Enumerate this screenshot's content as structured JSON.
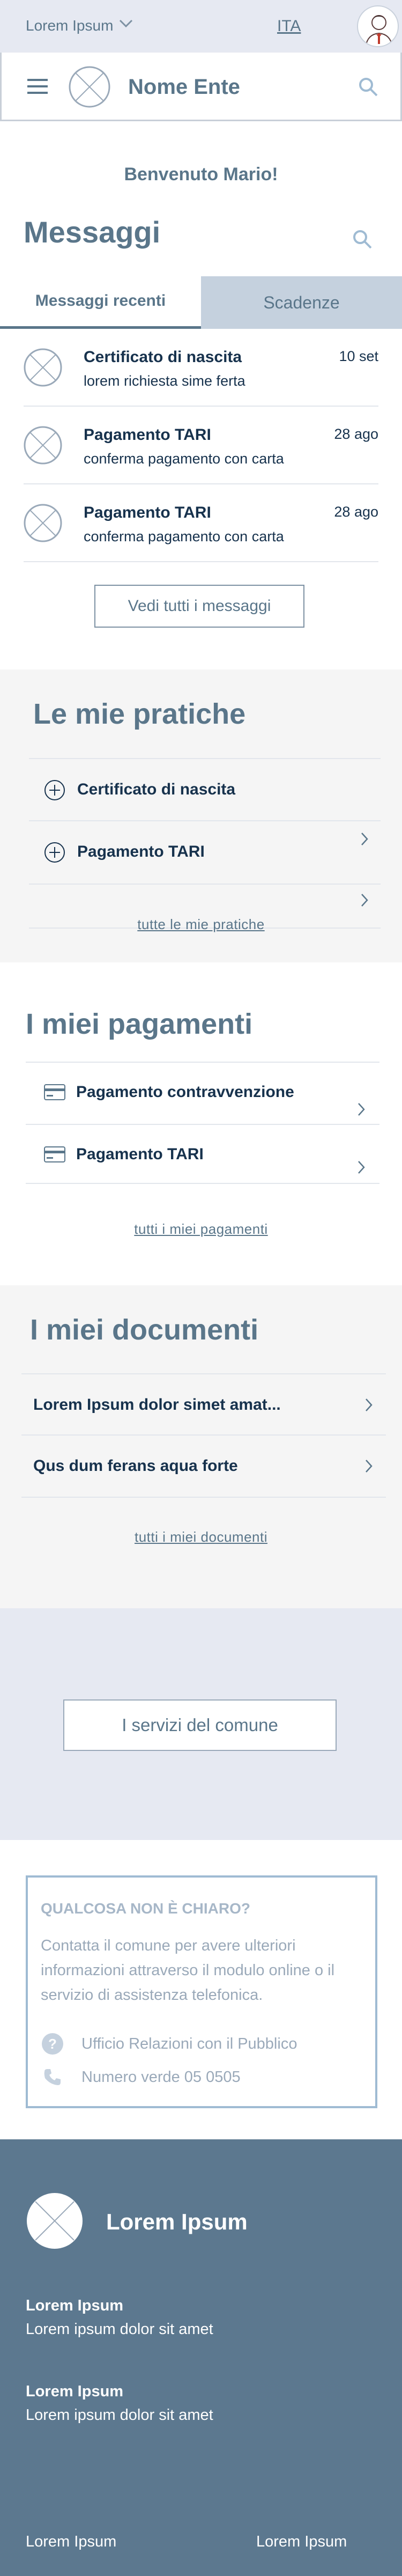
{
  "topbar": {
    "region": "Lorem Ipsum",
    "language": "ITA"
  },
  "header": {
    "entity_name": "Nome Ente"
  },
  "welcome": "Benvenuto Mario!",
  "messages": {
    "title": "Messaggi",
    "tabs": [
      "Messaggi recenti",
      "Scadenze"
    ],
    "items": [
      {
        "title": "Certificato di nascita",
        "subtitle": "lorem richiesta sime ferta",
        "date": "10 set"
      },
      {
        "title": "Pagamento TARI",
        "subtitle": "conferma pagamento con carta",
        "date": "28 ago"
      },
      {
        "title": "Pagamento TARI",
        "subtitle": "conferma pagamento con carta",
        "date": "28 ago"
      }
    ],
    "see_all": "Vedi tutti i messaggi"
  },
  "pratiche": {
    "title": "Le mie pratiche",
    "items": [
      "Certificato di nascita",
      "Pagamento TARI"
    ],
    "link": "tutte le mie pratiche"
  },
  "pagamenti": {
    "title": "I miei pagamenti",
    "items": [
      "Pagamento contravvenzione",
      "Pagamento TARI"
    ],
    "link": "tutti i miei pagamenti"
  },
  "documenti": {
    "title": "I miei documenti",
    "items": [
      "Lorem Ipsum dolor simet amat...",
      "Qus dum ferans aqua forte"
    ],
    "link": "tutti i miei documenti"
  },
  "services_button": "I servizi del comune",
  "help": {
    "title": "QUALCOSA NON È CHIARO?",
    "text": "Contatta il comune per avere ulteriori informazioni attraverso il modulo online o il servizio di assistenza telefonica.",
    "office": "Ufficio Relazioni con il Pubblico",
    "phone": "Numero verde 05 0505"
  },
  "footer": {
    "brand": "Lorem Ipsum",
    "blocks": [
      {
        "title": "Lorem Ipsum",
        "text": "Lorem ipsum dolor sit amet"
      },
      {
        "title": "Lorem Ipsum",
        "text": "Lorem ipsum dolor sit amet"
      }
    ],
    "links": [
      "Lorem Ipsum",
      "Lorem Ipsum"
    ]
  },
  "colors": {
    "primary": "#5a768a",
    "text_dark": "#17324d",
    "topbar_bg": "#e6e9f2",
    "tab_inactive_bg": "#c5d1de",
    "section_grey": "#f5f5f5",
    "services_bg": "#e6e9f2",
    "help_border": "#9fbbd3",
    "footer_bg": "#5c788f"
  }
}
